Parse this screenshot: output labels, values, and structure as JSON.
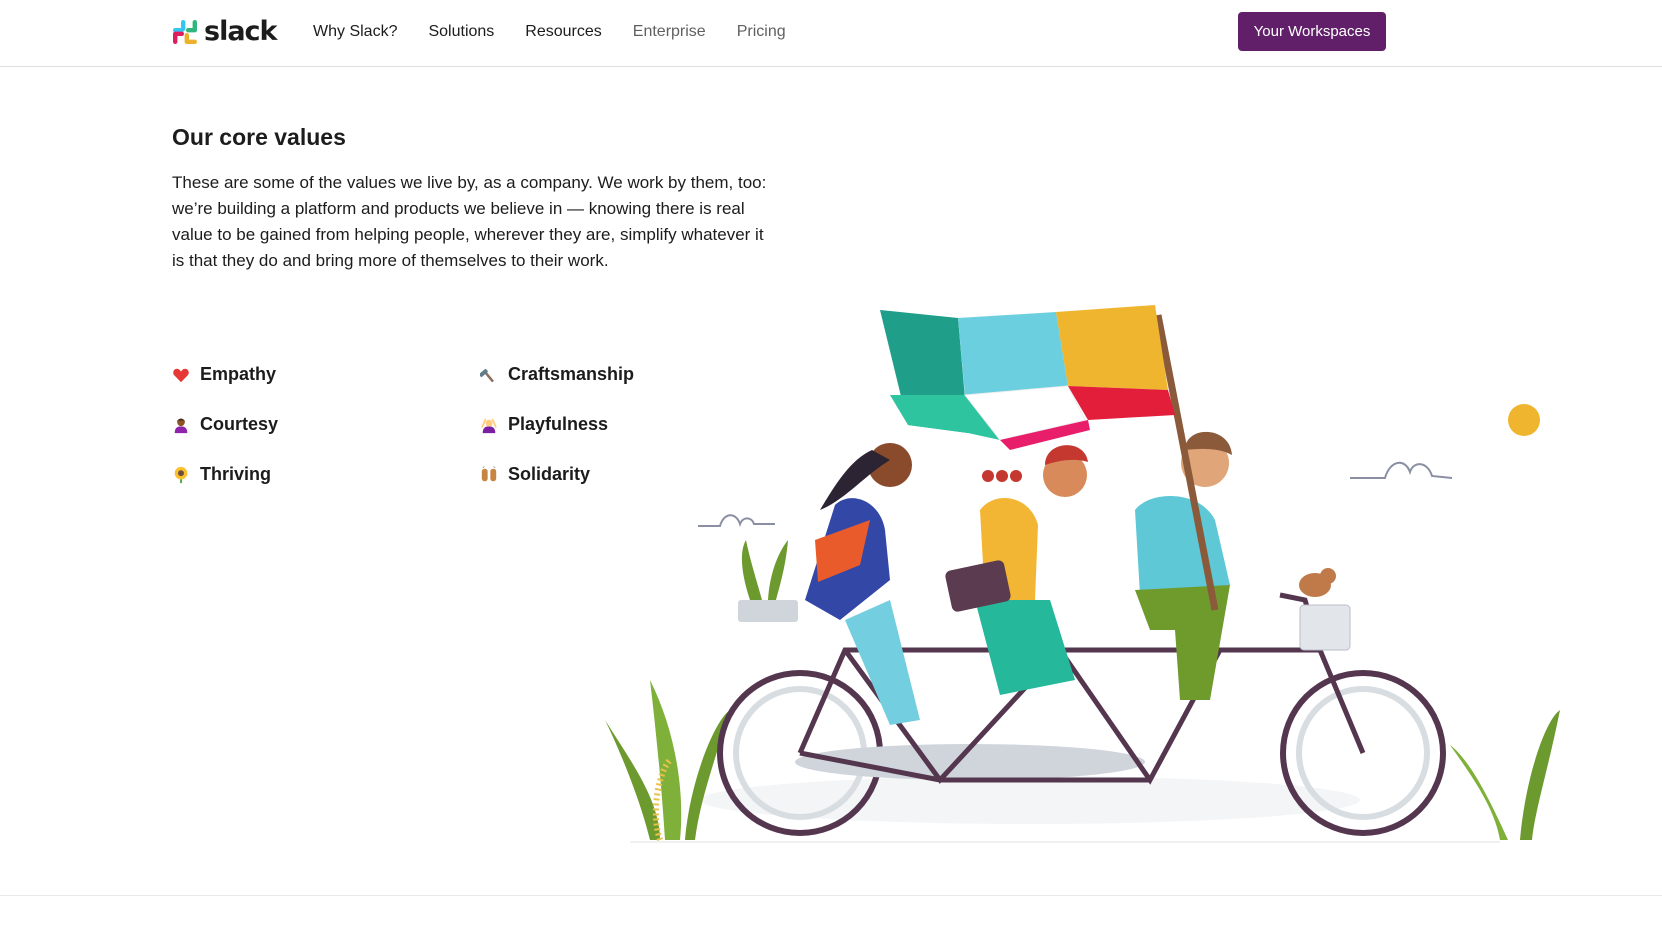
{
  "brand": {
    "name": "slack",
    "colors": {
      "blue": "#36C5F0",
      "green": "#2EB67D",
      "yellow": "#ECB22E",
      "red": "#E01E5A"
    }
  },
  "nav": {
    "items": [
      "Why Slack?",
      "Solutions",
      "Resources",
      "Enterprise",
      "Pricing"
    ]
  },
  "cta": {
    "label": "Your Workspaces",
    "color": "#611f69"
  },
  "section": {
    "title": "Our core values",
    "description": "These are some of the values we live by, as a company. We work by them, too: we’re building a platform and products we believe in — knowing there is real value to be gained from helping people, wherever they are, simplify whatever it is that they do and bring more of themselves to their work."
  },
  "values": [
    {
      "label": "Empathy",
      "icon": "heart-icon"
    },
    {
      "label": "Craftsmanship",
      "icon": "hammer-icon"
    },
    {
      "label": "Courtesy",
      "icon": "person-tipping-hand-icon"
    },
    {
      "label": "Playfulness",
      "icon": "person-gesturing-icon"
    },
    {
      "label": "Thriving",
      "icon": "sunflower-icon"
    },
    {
      "label": "Solidarity",
      "icon": "raised-hands-icon"
    }
  ]
}
